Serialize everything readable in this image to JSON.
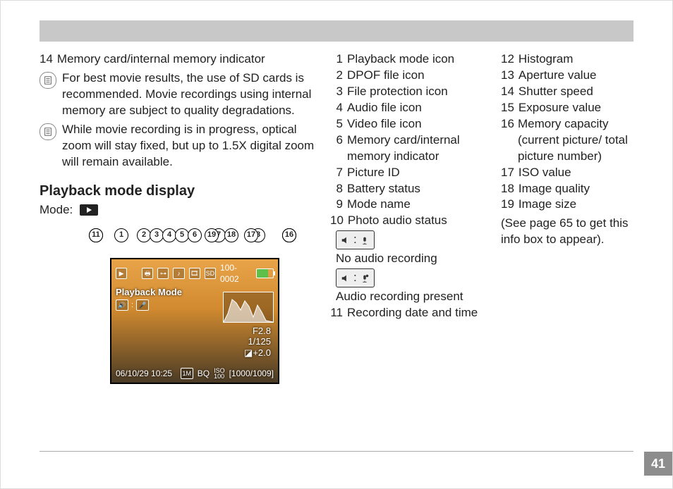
{
  "page_number": "41",
  "left": {
    "item14": {
      "n": "14",
      "t": "Memory card/internal memory indicator"
    },
    "note1": "For best movie results, the use of SD cards is recommended. Movie recordings using internal memory are subject to quality degradations.",
    "note2": "While movie recording is in progress, optical zoom will stay fixed, but up to 1.5X digital zoom will remain available.",
    "heading": "Playback mode display",
    "mode_label": "Mode:"
  },
  "screen": {
    "sd_label": "SD",
    "pic_id": "100-0002",
    "mode_name": "Playback Mode",
    "aperture": "F2.8",
    "shutter": "1/125",
    "exposure": "+2.0",
    "datetime": "06/10/29 10:25",
    "size": "1M",
    "quality": "BQ",
    "iso": "ISO 100",
    "capacity": "[1000/1009]"
  },
  "legend_col1": [
    {
      "n": "1",
      "t": "Playback mode icon"
    },
    {
      "n": "2",
      "t": "DPOF file icon"
    },
    {
      "n": "3",
      "t": "File protection icon"
    },
    {
      "n": "4",
      "t": "Audio file icon"
    },
    {
      "n": "5",
      "t": "Video file icon"
    },
    {
      "n": "6",
      "t": "Memory card/internal memory indicator"
    },
    {
      "n": "7",
      "t": "Picture ID"
    },
    {
      "n": "8",
      "t": "Battery status"
    },
    {
      "n": "9",
      "t": "Mode name"
    },
    {
      "n": "10",
      "t": "Photo audio status"
    }
  ],
  "audio_status": {
    "no_audio": "No audio recording",
    "audio_present": "Audio recording present"
  },
  "legend_col1_tail": {
    "n": "11",
    "t": "Recording date and time"
  },
  "legend_col2": [
    {
      "n": "12",
      "t": "Histogram"
    },
    {
      "n": "13",
      "t": "Aperture value"
    },
    {
      "n": "14",
      "t": "Shutter speed"
    },
    {
      "n": "15",
      "t": "Exposure value"
    },
    {
      "n": "16",
      "t": "Memory capacity (current picture/ total picture number)"
    },
    {
      "n": "17",
      "t": "ISO value"
    },
    {
      "n": "18",
      "t": "Image quality"
    },
    {
      "n": "19",
      "t": "Image size"
    }
  ],
  "note_right": "(See page 65 to get this info box to appear)."
}
